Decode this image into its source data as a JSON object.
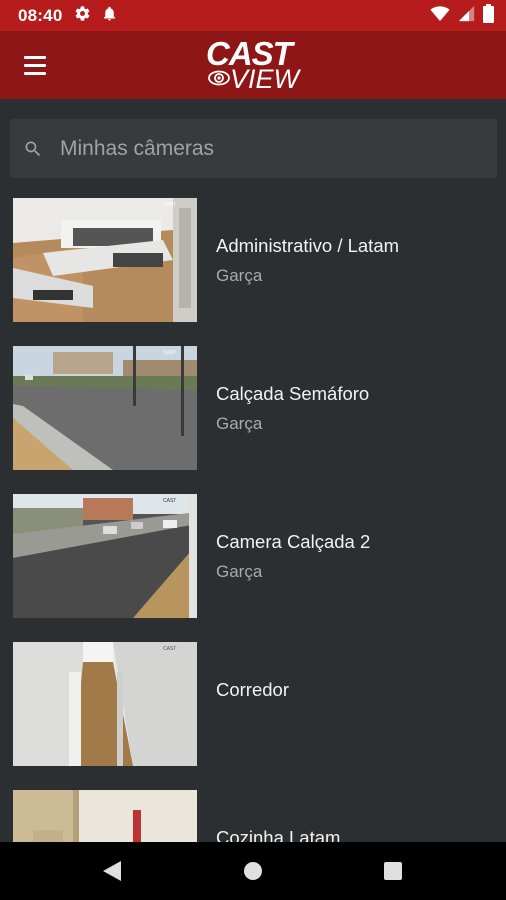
{
  "status_bar": {
    "time": "08:40",
    "left_icons": [
      "gear-icon",
      "notification-bell-icon"
    ],
    "right_icons": [
      "wifi-icon",
      "cell-signal-icon",
      "battery-icon"
    ]
  },
  "app_bar": {
    "menu_icon": "hamburger-menu-icon",
    "logo_top": "CAST",
    "logo_bottom": "VIEW"
  },
  "search": {
    "placeholder": "Minhas câmeras",
    "value": ""
  },
  "cameras": [
    {
      "name": "Administrativo / Latam",
      "location": "Garça",
      "thumbnail": "office-interior"
    },
    {
      "name": "Calçada Semáforo",
      "location": "Garça",
      "thumbnail": "street-sidewalk"
    },
    {
      "name": "Camera Calçada 2",
      "location": "Garça",
      "thumbnail": "street-cars"
    },
    {
      "name": "Corredor",
      "location": "",
      "thumbnail": "hallway"
    },
    {
      "name": "Cozinha Latam",
      "location": "",
      "thumbnail": "kitchen"
    }
  ],
  "nav_bar": {
    "icons": [
      "back-triangle-icon",
      "home-circle-icon",
      "recents-square-icon"
    ]
  },
  "colors": {
    "status_bar": "#b71c1c",
    "app_bar": "#8e1616",
    "background": "#2b2f31",
    "search_bg": "#373b3e",
    "primary_text": "#f2f2f2",
    "secondary_text": "#a7abad"
  }
}
